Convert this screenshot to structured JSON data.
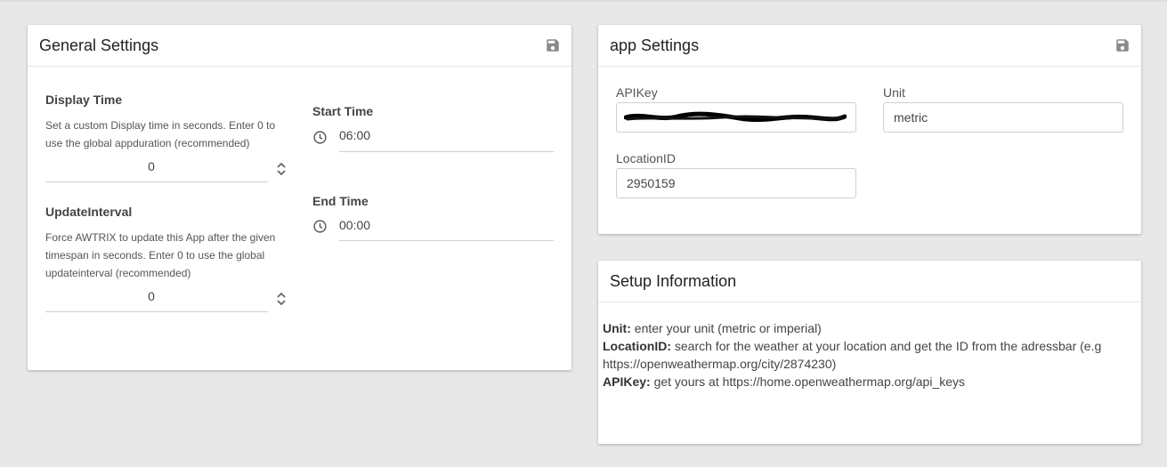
{
  "general": {
    "title": "General Settings",
    "display_time": {
      "label": "Display Time",
      "description_line1": "Set a custom Display time in seconds. Enter 0 to",
      "description_line2": "use the global appduration (recommended)",
      "value": "0"
    },
    "update_interval": {
      "label": "UpdateInterval",
      "description_line1": "Force AWTRIX to update this App after the given",
      "description_line2": "timespan in seconds. Enter 0 to use the global",
      "description_line3": "updateinterval (recommended)",
      "value": "0"
    },
    "start_time": {
      "label": "Start Time",
      "value": "06:00"
    },
    "end_time": {
      "label": "End Time",
      "value": "00:00"
    }
  },
  "app_settings": {
    "title": "app Settings",
    "apikey": {
      "label": "APIKey"
    },
    "unit": {
      "label": "Unit",
      "value": "metric"
    },
    "location_id": {
      "label": "LocationID",
      "value": "2950159"
    }
  },
  "setup": {
    "title": "Setup Information",
    "unit_key": "Unit:",
    "unit_text": " enter your unit (metric or imperial)",
    "location_key": "LocationID:",
    "location_text": " search for the weather at your location and get the ID from the adressbar (e.g",
    "location_url": "https://openweathermap.org/city/2874230)",
    "apikey_key": "APIKey:",
    "apikey_text": " get yours at https://home.openweathermap.org/api_keys"
  },
  "icons": {
    "save": "floppy-disk-icon",
    "clock": "clock-icon",
    "stepper": "up-down-chevron-icon"
  },
  "colors": {
    "background": "#e8e8e8",
    "card": "#ffffff",
    "icon": "#8a8a8a"
  }
}
